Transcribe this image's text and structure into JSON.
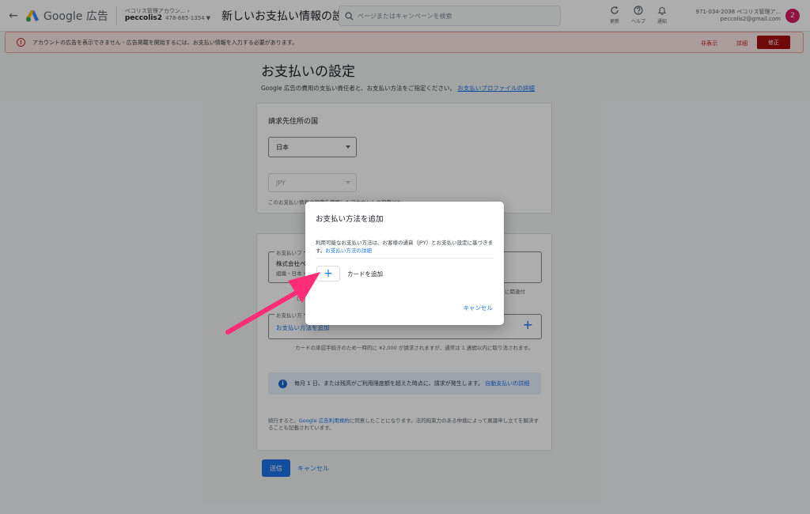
{
  "topbar": {
    "product_name": "Google 広告",
    "account_small": "ペコリス管理アカウン...",
    "account_name": "peccolis2",
    "customer_id": "478-685-1354",
    "page_title": "新しいお支払い情報の設定",
    "search_placeholder": "ページまたはキャンペーンを検索",
    "tools": [
      {
        "label": "更新",
        "icon": "refresh-icon"
      },
      {
        "label": "ヘルプ",
        "icon": "help-icon"
      },
      {
        "label": "通知",
        "icon": "bell-icon"
      }
    ],
    "user_line1": "971-034-2038 ペコリス管理ア...",
    "user_line2": "peccolis2@gmail.com",
    "avatar_letter": "2"
  },
  "alert": {
    "text": "アカウントの広告を表示できません - 広告掲載を開始するには、お支払い情報を入力する必要があります。",
    "hide": "非表示",
    "details": "詳細",
    "fix": "修正"
  },
  "main": {
    "title": "お支払いの設定",
    "description": "Google 広告の費用の支払い責任者と、お支払い方法をご指定ください。",
    "description_link": "お支払いプロファイルの詳細",
    "country_label": "請求先住所の国",
    "country_value": "日本",
    "currency_value": "JPY",
    "currency_note": "このお支払い情報の設定を使用したアカウントの設定ども",
    "profile_label": "お支払いプ",
    "profile_line1": "株式会社ペ",
    "profile_line2": "組織・日本・",
    "profile_note_a": "お支",
    "profile_note_b": "ントに関連付",
    "profile_note_c": "け",
    "method_label": "お支払い方",
    "method_value": "お支払い方法を追加",
    "card_note": "カードの承認手続きのため一時的に ¥2,000 が請求されますが、通常は 1 週間以内に取り消されます。",
    "info_text": "毎月 1 日、または残高がご利用限度額を超えた時点に、請求が発生します。",
    "info_link": "自動支払いの詳細",
    "terms_prefix": "続行すると、",
    "terms_link": "Google 広告利用規約",
    "terms_suffix": "に同意したことになります。法的拘束力のある仲裁によって異議申し立てを解決することも記載されています。",
    "submit": "送信",
    "cancel": "キャンセル"
  },
  "dialog": {
    "title": "お支払い方法を追加",
    "description": "利用可能なお支払い方法は、お客様の通貨（JPY）とお支払い設定に基づきます。",
    "description_link": "お支払い方法の詳細",
    "add_card_label": "カードを追加",
    "cancel": "キャンセル"
  },
  "colors": {
    "accent": "#1a73e8",
    "alert_bg": "#fce8e6",
    "alert_red": "#c5221f",
    "fix_button": "#a50e0e",
    "annotation_arrow": "#ff2d78",
    "avatar": "#d81b60"
  }
}
